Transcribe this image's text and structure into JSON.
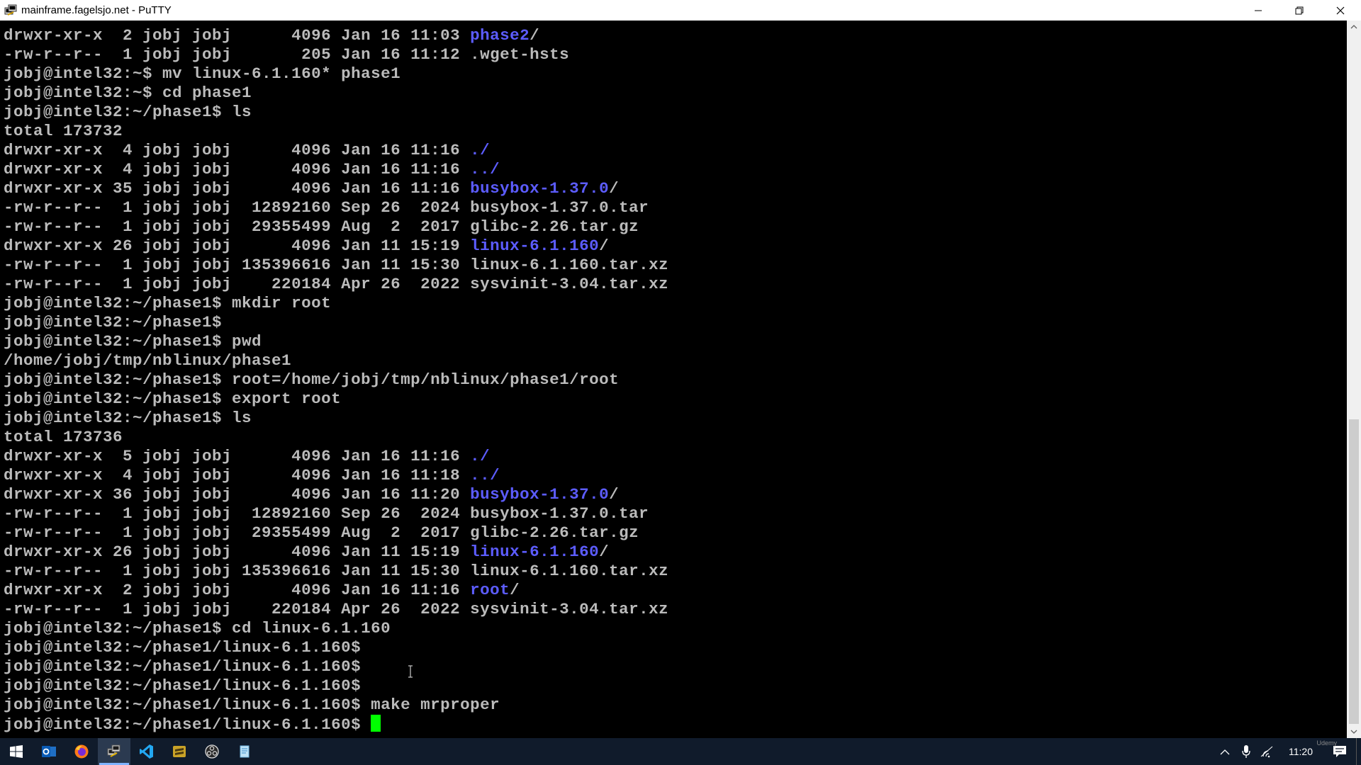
{
  "window": {
    "title": "mainframe.fagelsjo.net - PuTTY"
  },
  "terminal": {
    "lines": [
      {
        "segs": [
          {
            "t": "drwxr-xr-x  2 jobj jobj      4096 Jan 16 11:03 "
          },
          {
            "t": "phase2",
            "c": "dir"
          },
          {
            "t": "/"
          }
        ]
      },
      {
        "segs": [
          {
            "t": "-rw-r--r--  1 jobj jobj       205 Jan 16 11:12 .wget-hsts"
          }
        ]
      },
      {
        "segs": [
          {
            "t": "jobj@intel32:~$ mv linux-6.1.160* phase1"
          }
        ]
      },
      {
        "segs": [
          {
            "t": "jobj@intel32:~$ cd phase1"
          }
        ]
      },
      {
        "segs": [
          {
            "t": "jobj@intel32:~/phase1$ ls"
          }
        ]
      },
      {
        "segs": [
          {
            "t": "total 173732"
          }
        ]
      },
      {
        "segs": [
          {
            "t": "drwxr-xr-x  4 jobj jobj      4096 Jan 16 11:16 "
          },
          {
            "t": "./",
            "c": "dir"
          }
        ]
      },
      {
        "segs": [
          {
            "t": "drwxr-xr-x  4 jobj jobj      4096 Jan 16 11:16 "
          },
          {
            "t": "../",
            "c": "dir"
          }
        ]
      },
      {
        "segs": [
          {
            "t": "drwxr-xr-x 35 jobj jobj      4096 Jan 16 11:16 "
          },
          {
            "t": "busybox-1.37.0",
            "c": "dir"
          },
          {
            "t": "/"
          }
        ]
      },
      {
        "segs": [
          {
            "t": "-rw-r--r--  1 jobj jobj  12892160 Sep 26  2024 busybox-1.37.0.tar"
          }
        ]
      },
      {
        "segs": [
          {
            "t": "-rw-r--r--  1 jobj jobj  29355499 Aug  2  2017 glibc-2.26.tar.gz"
          }
        ]
      },
      {
        "segs": [
          {
            "t": "drwxr-xr-x 26 jobj jobj      4096 Jan 11 15:19 "
          },
          {
            "t": "linux-6.1.160",
            "c": "dir"
          },
          {
            "t": "/"
          }
        ]
      },
      {
        "segs": [
          {
            "t": "-rw-r--r--  1 jobj jobj 135396616 Jan 11 15:30 linux-6.1.160.tar.xz"
          }
        ]
      },
      {
        "segs": [
          {
            "t": "-rw-r--r--  1 jobj jobj    220184 Apr 26  2022 sysvinit-3.04.tar.xz"
          }
        ]
      },
      {
        "segs": [
          {
            "t": "jobj@intel32:~/phase1$ mkdir root"
          }
        ]
      },
      {
        "segs": [
          {
            "t": "jobj@intel32:~/phase1$"
          }
        ]
      },
      {
        "segs": [
          {
            "t": "jobj@intel32:~/phase1$ pwd"
          }
        ]
      },
      {
        "segs": [
          {
            "t": "/home/jobj/tmp/nblinux/phase1"
          }
        ]
      },
      {
        "segs": [
          {
            "t": "jobj@intel32:~/phase1$ root=/home/jobj/tmp/nblinux/phase1/root"
          }
        ]
      },
      {
        "segs": [
          {
            "t": "jobj@intel32:~/phase1$ export root"
          }
        ]
      },
      {
        "segs": [
          {
            "t": "jobj@intel32:~/phase1$ ls"
          }
        ]
      },
      {
        "segs": [
          {
            "t": "total 173736"
          }
        ]
      },
      {
        "segs": [
          {
            "t": "drwxr-xr-x  5 jobj jobj      4096 Jan 16 11:16 "
          },
          {
            "t": "./",
            "c": "dir"
          }
        ]
      },
      {
        "segs": [
          {
            "t": "drwxr-xr-x  4 jobj jobj      4096 Jan 16 11:18 "
          },
          {
            "t": "../",
            "c": "dir"
          }
        ]
      },
      {
        "segs": [
          {
            "t": "drwxr-xr-x 36 jobj jobj      4096 Jan 16 11:20 "
          },
          {
            "t": "busybox-1.37.0",
            "c": "dir"
          },
          {
            "t": "/"
          }
        ]
      },
      {
        "segs": [
          {
            "t": "-rw-r--r--  1 jobj jobj  12892160 Sep 26  2024 busybox-1.37.0.tar"
          }
        ]
      },
      {
        "segs": [
          {
            "t": "-rw-r--r--  1 jobj jobj  29355499 Aug  2  2017 glibc-2.26.tar.gz"
          }
        ]
      },
      {
        "segs": [
          {
            "t": "drwxr-xr-x 26 jobj jobj      4096 Jan 11 15:19 "
          },
          {
            "t": "linux-6.1.160",
            "c": "dir"
          },
          {
            "t": "/"
          }
        ]
      },
      {
        "segs": [
          {
            "t": "-rw-r--r--  1 jobj jobj 135396616 Jan 11 15:30 linux-6.1.160.tar.xz"
          }
        ]
      },
      {
        "segs": [
          {
            "t": "drwxr-xr-x  2 jobj jobj      4096 Jan 16 11:16 "
          },
          {
            "t": "root",
            "c": "dir"
          },
          {
            "t": "/"
          }
        ]
      },
      {
        "segs": [
          {
            "t": "-rw-r--r--  1 jobj jobj    220184 Apr 26  2022 sysvinit-3.04.tar.xz"
          }
        ]
      },
      {
        "segs": [
          {
            "t": "jobj@intel32:~/phase1$ cd linux-6.1.160"
          }
        ]
      },
      {
        "segs": [
          {
            "t": "jobj@intel32:~/phase1/linux-6.1.160$"
          }
        ]
      },
      {
        "segs": [
          {
            "t": "jobj@intel32:~/phase1/linux-6.1.160$"
          }
        ]
      },
      {
        "segs": [
          {
            "t": "jobj@intel32:~/phase1/linux-6.1.160$"
          }
        ]
      },
      {
        "segs": [
          {
            "t": "jobj@intel32:~/phase1/linux-6.1.160$ make mrproper"
          }
        ]
      },
      {
        "segs": [
          {
            "t": "jobj@intel32:~/phase1/linux-6.1.160$ "
          }
        ],
        "cursor": true
      }
    ],
    "colors": {
      "foreground": "#bbbbbb",
      "background": "#000000",
      "directory": "#5c5cff",
      "cursor": "#00ff00"
    }
  },
  "taskbar": {
    "apps": [
      {
        "name": "start-button-icon"
      },
      {
        "name": "outlook-icon"
      },
      {
        "name": "firefox-icon"
      },
      {
        "name": "putty-icon",
        "active": true
      },
      {
        "name": "vscode-icon"
      },
      {
        "name": "sublime-text-icon"
      },
      {
        "name": "obs-icon"
      },
      {
        "name": "notepad-icon"
      }
    ],
    "clock": "11:20",
    "watermark": "Udemy"
  }
}
